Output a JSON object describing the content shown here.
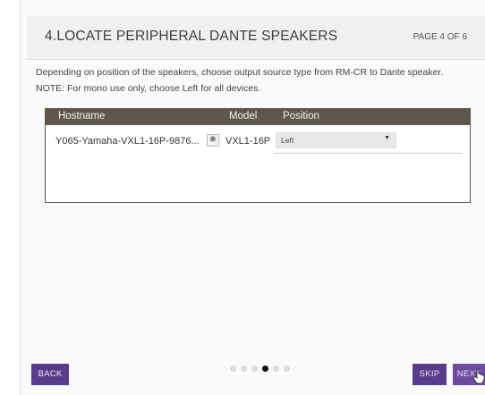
{
  "header": {
    "title": "4.LOCATE PERIPHERAL DANTE SPEAKERS",
    "page_indicator": "PAGE 4 OF 6"
  },
  "instructions": {
    "line1": "Depending on position of the speakers, choose output source type from RM-CR to Dante speaker.",
    "line2": "NOTE: For mono use only, choose Left for all devices."
  },
  "table": {
    "columns": [
      "Hostname",
      "Model",
      "Position"
    ],
    "rows": [
      {
        "hostname": "Y065-Yamaha-VXL1-16P-9876...",
        "model": "VXL1-16P",
        "position": "Left"
      }
    ]
  },
  "footer": {
    "back_label": "BACK",
    "skip_label": "SKIP",
    "next_label": "NEXT",
    "page_count": 6,
    "current_page": 4
  },
  "colors": {
    "button": "#5a3d8a",
    "table_header": "#5e584c"
  }
}
